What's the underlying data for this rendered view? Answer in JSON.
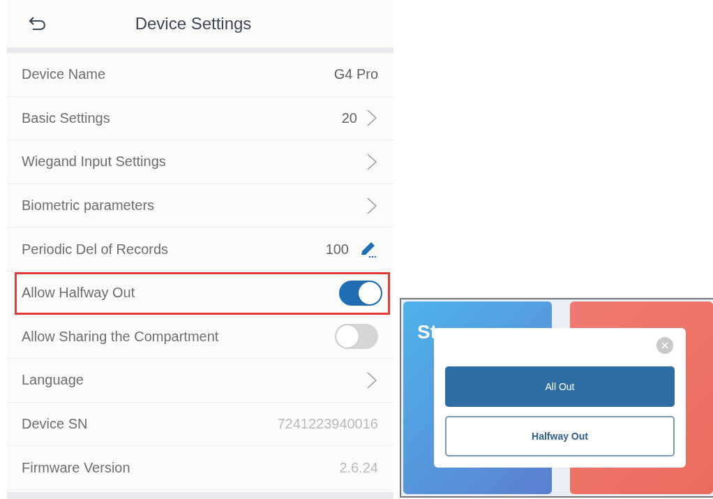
{
  "header": {
    "title": "Device Settings"
  },
  "rows": [
    {
      "kind": "value",
      "label": "Device Name",
      "value": "G4 Pro",
      "highlighted": false
    },
    {
      "kind": "link",
      "label": "Basic Settings",
      "value": "20",
      "highlighted": false
    },
    {
      "kind": "link",
      "label": "Wiegand Input Settings",
      "highlighted": false
    },
    {
      "kind": "link",
      "label": "Biometric parameters",
      "highlighted": false
    },
    {
      "kind": "edit",
      "label": "Periodic Del of Records",
      "value": "100",
      "highlighted": false
    },
    {
      "kind": "toggle",
      "label": "Allow Halfway Out",
      "on": true,
      "highlighted": true
    },
    {
      "kind": "toggle",
      "label": "Allow Sharing the Compartment",
      "on": false,
      "highlighted": false
    },
    {
      "kind": "link",
      "label": "Language",
      "highlighted": false
    },
    {
      "kind": "readonly",
      "label": "Device SN",
      "value": "7241223940016",
      "highlighted": false
    },
    {
      "kind": "readonly",
      "label": "Firmware Version",
      "value": "2.6.24",
      "highlighted": false
    }
  ],
  "device_screen": {
    "card_partial_title": "St",
    "dialog": {
      "buttons": [
        {
          "label": "All Out",
          "selected": true
        },
        {
          "label": "Halfway Out",
          "selected": false
        }
      ]
    }
  }
}
